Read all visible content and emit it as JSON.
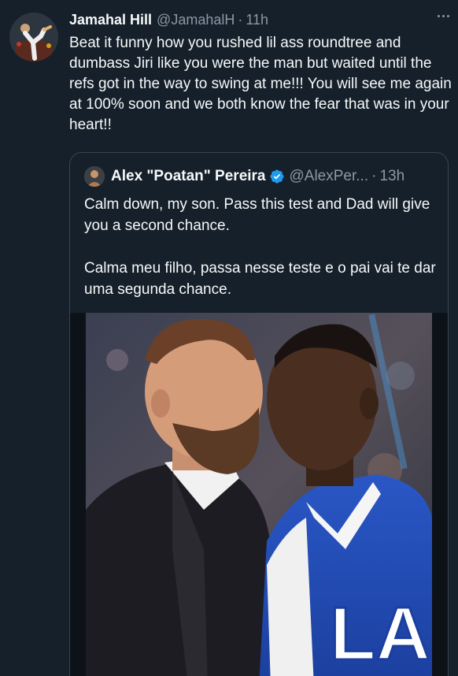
{
  "tweet": {
    "author_name": "Jamahal Hill",
    "author_handle": "@JamahalH",
    "separator": "·",
    "time": "11h",
    "avatar_icon": "user-avatar-photo",
    "more_icon": "more-options-icon",
    "text": "Beat it funny how you rushed lil ass roundtree and dumbass Jiri like you were the man but waited until the refs got in the way to swing at me!!! You will see me again at 100% soon and we both know the fear that was in your heart!!"
  },
  "quoted_tweet": {
    "author_name": "Alex \"Poatan\" Pereira",
    "author_handle": "@AlexPer...",
    "separator": "·",
    "time": "13h",
    "verified_icon": "verified-badge-icon",
    "verified_color": "#1d9bf0",
    "paragraphs": [
      "Calm down, my son. Pass this test and Dad will give you a second chance.",
      "Calma meu filho, passa nesse teste e o pai vai te dar uma segunda chance."
    ],
    "image": {
      "description_icon": "face-off-photo",
      "jacket_letters": "LA"
    }
  },
  "colors": {
    "background": "#15202b",
    "text_primary": "#f7f9f9",
    "text_secondary": "#8b98a5",
    "border": "#38444d"
  }
}
